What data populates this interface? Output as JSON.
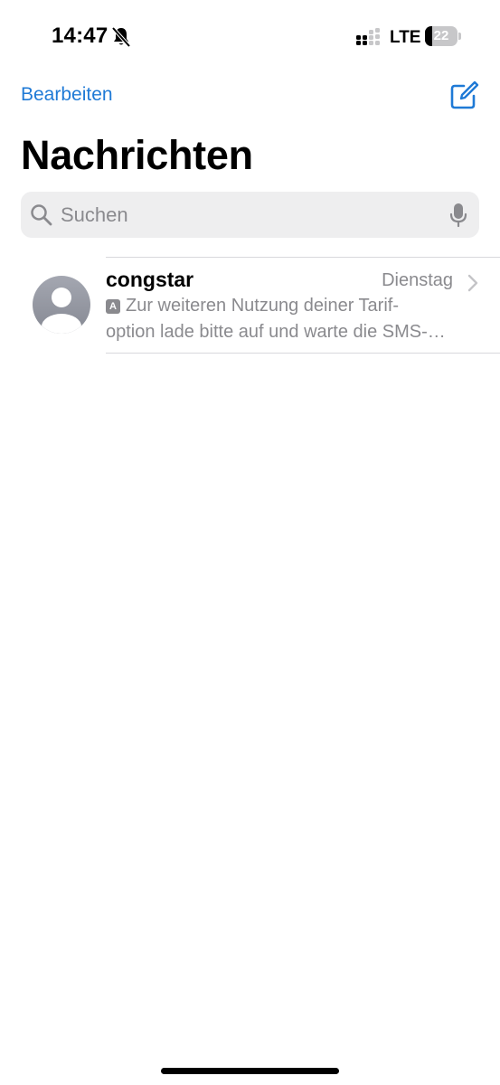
{
  "status_bar": {
    "time": "14:47",
    "silent_icon": "bell-slash-icon",
    "signal_icon": "cellular-signal-icon",
    "network": "LTE",
    "battery_level": "22",
    "battery_fraction": 0.22
  },
  "nav": {
    "edit_label": "Bearbeiten",
    "compose_icon": "compose-icon",
    "accent_color": "#1f7ad6"
  },
  "page": {
    "title": "Nachrichten"
  },
  "search": {
    "placeholder": "Suchen",
    "value": "",
    "icon": "search-icon",
    "mic_icon": "microphone-icon"
  },
  "conversations": [
    {
      "sender": "congstar",
      "date": "Dienstag",
      "avatar_icon": "person-avatar-icon",
      "badge": "A",
      "preview_line_1": "Zur weiteren Nutzung deiner Tarif-",
      "preview_line_2": "option lade bitte auf und warte die SMS-…"
    }
  ]
}
